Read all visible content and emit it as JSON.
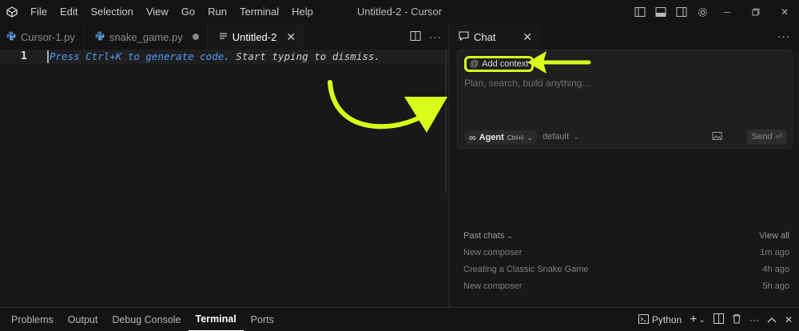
{
  "titlebar": {
    "menu": [
      "File",
      "Edit",
      "Selection",
      "View",
      "Go",
      "Run",
      "Terminal",
      "Help"
    ],
    "window_title": "Untitled-2 - Cursor"
  },
  "tabs": [
    {
      "label": "Cursor-1.py",
      "icon": "python-icon",
      "state": "inactive"
    },
    {
      "label": "snake_game.py",
      "icon": "python-icon",
      "state": "modified"
    },
    {
      "label": "Untitled-2",
      "icon": "file-lines-icon",
      "state": "active"
    }
  ],
  "editor": {
    "line_number": "1",
    "hint_key": "Press Ctrl+K to generate code.",
    "hint_rest": " Start typing to dismiss."
  },
  "chat": {
    "tab_label": "Chat",
    "add_context": "Add context",
    "placeholder": "Plan, search, build anything...",
    "agent_label": "Agent",
    "agent_shortcut": "Ctrl+I",
    "model": "default",
    "send_label": "Send",
    "past_chats_label": "Past chats",
    "view_all": "View all",
    "history": [
      {
        "title": "New composer",
        "time": "1m ago"
      },
      {
        "title": "Creating a Classic Snake Game",
        "time": "4h ago"
      },
      {
        "title": "New composer",
        "time": "5h ago"
      }
    ]
  },
  "panel": {
    "tabs": [
      "Problems",
      "Output",
      "Debug Console",
      "Terminal",
      "Ports"
    ],
    "active_tab": "Terminal",
    "terminal_profile": "Python"
  },
  "colors": {
    "annotation": "#d7ff1a",
    "accent_blue": "#4d9bf5"
  }
}
